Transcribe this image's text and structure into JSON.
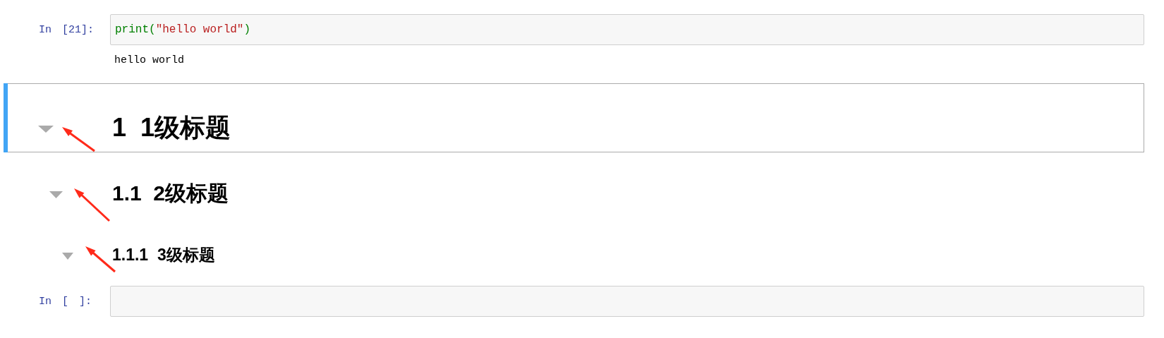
{
  "cells": [
    {
      "kind": "code",
      "prompt": "In [21]:",
      "tokens": [
        {
          "kind": "builtin",
          "text": "print"
        },
        {
          "kind": "paren",
          "text": "("
        },
        {
          "kind": "string",
          "text": "\"hello world\""
        },
        {
          "kind": "paren",
          "text": ")"
        }
      ],
      "output": "hello world"
    },
    {
      "kind": "h1",
      "number": "1",
      "text": "1级标题",
      "expanded": true,
      "annotated": true,
      "selected": true
    },
    {
      "kind": "h2",
      "number": "1.1",
      "text": "2级标题",
      "expanded": true,
      "annotated": true,
      "selected": false
    },
    {
      "kind": "h3",
      "number": "1.1.1",
      "text": "3级标题",
      "expanded": true,
      "annotated": true,
      "selected": false
    },
    {
      "kind": "code",
      "prompt": "In [ ]:"
    }
  ]
}
